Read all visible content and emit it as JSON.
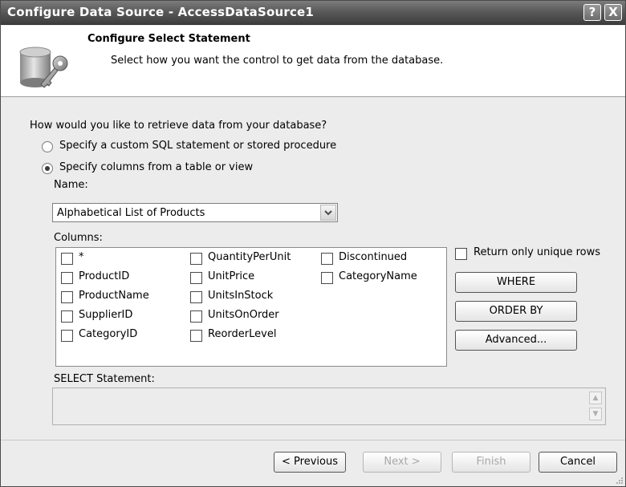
{
  "window": {
    "title": "Configure Data Source - AccessDataSource1",
    "help_label": "?",
    "close_label": "X"
  },
  "header": {
    "title": "Configure Select Statement",
    "subtitle": "Select how you want the control to get data from the database."
  },
  "question": "How would you like to retrieve data from your database?",
  "options": {
    "custom_sql": "Specify a custom SQL statement or stored procedure",
    "columns": "Specify columns from a table or view"
  },
  "name_label": "Name:",
  "name_value": "Alphabetical List of Products",
  "columns_label": "Columns:",
  "columns": [
    [
      "*",
      "ProductID",
      "ProductName",
      "SupplierID",
      "CategoryID"
    ],
    [
      "QuantityPerUnit",
      "UnitPrice",
      "UnitsInStock",
      "UnitsOnOrder",
      "ReorderLevel"
    ],
    [
      "Discontinued",
      "CategoryName"
    ]
  ],
  "unique_rows_label": "Return only unique rows",
  "buttons": {
    "where": "WHERE",
    "order_by": "ORDER BY",
    "advanced": "Advanced...",
    "previous": "< Previous",
    "next": "Next >",
    "finish": "Finish",
    "cancel": "Cancel"
  },
  "select_statement_label": "SELECT Statement:",
  "select_statement_value": ""
}
